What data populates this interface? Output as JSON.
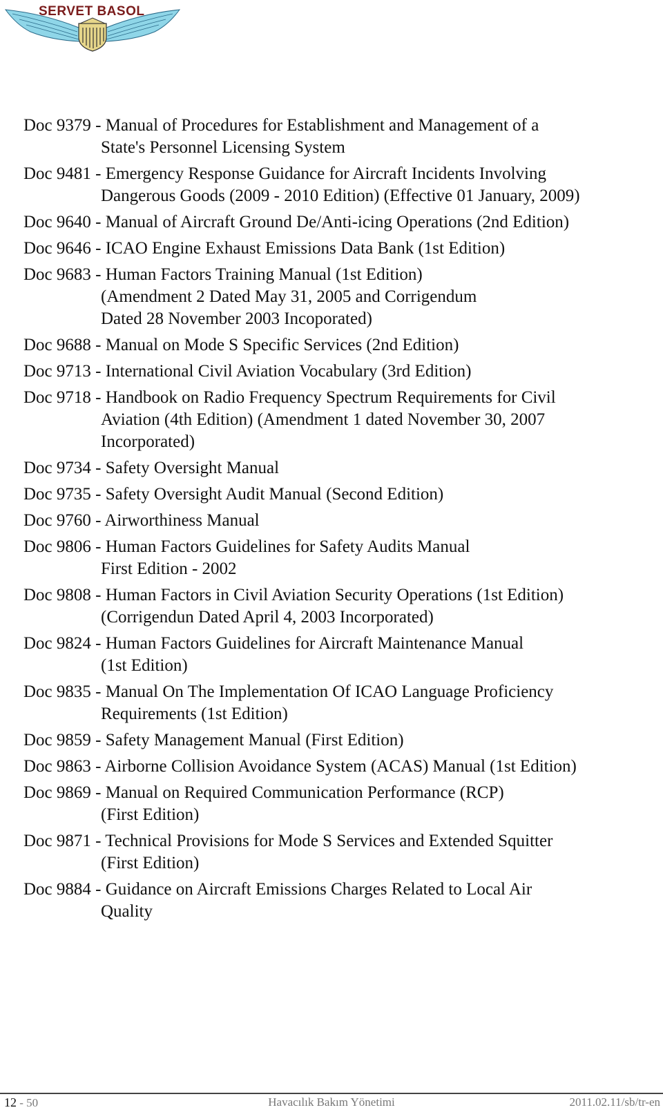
{
  "header": {
    "logo_text": "SERVET BASOL",
    "colors": {
      "logo_text": "#7a1c1c",
      "wings": "#8fd6e8",
      "shield": "#e6d68a"
    }
  },
  "documents": [
    {
      "number": "Doc 9379",
      "lines": [
        "Manual of Procedures for Establishment and Management of a",
        "State's Personnel Licensing System"
      ]
    },
    {
      "number": "Doc 9481",
      "lines": [
        "Emergency Response Guidance for Aircraft Incidents Involving",
        "Dangerous Goods (2009 - 2010 Edition) (Effective 01 January, 2009)"
      ]
    },
    {
      "number": "Doc 9640",
      "lines": [
        "Manual of Aircraft Ground De/Anti-icing Operations (2nd Edition)"
      ]
    },
    {
      "number": "Doc 9646",
      "lines": [
        "ICAO Engine Exhaust Emissions Data Bank (1st Edition)"
      ]
    },
    {
      "number": "Doc 9683",
      "lines": [
        "Human Factors Training Manual (1st Edition)",
        "(Amendment 2 Dated May 31, 2005 and Corrigendum",
        "Dated 28 November 2003 Incoporated)"
      ]
    },
    {
      "number": "Doc 9688",
      "lines": [
        "Manual on Mode S Specific Services (2nd Edition)"
      ]
    },
    {
      "number": "Doc 9713",
      "lines": [
        "International Civil Aviation Vocabulary (3rd Edition)"
      ]
    },
    {
      "number": "Doc 9718",
      "lines": [
        "Handbook on Radio Frequency Spectrum Requirements for Civil",
        "Aviation (4th Edition) (Amendment 1 dated November 30, 2007",
        "Incorporated)"
      ]
    },
    {
      "number": "Doc 9734",
      "lines": [
        "Safety Oversight Manual"
      ]
    },
    {
      "number": "Doc 9735",
      "lines": [
        "Safety Oversight Audit Manual (Second Edition)"
      ]
    },
    {
      "number": "Doc 9760",
      "lines": [
        "Airworthiness Manual"
      ]
    },
    {
      "number": "Doc 9806",
      "lines": [
        "Human Factors Guidelines for Safety Audits Manual",
        "First Edition - 2002"
      ]
    },
    {
      "number": "Doc 9808",
      "lines": [
        "Human Factors in Civil Aviation Security Operations (1st Edition)",
        "(Corrigendun Dated April 4, 2003 Incorporated)"
      ]
    },
    {
      "number": "Doc 9824",
      "lines": [
        "Human Factors Guidelines for Aircraft Maintenance Manual",
        "(1st Edition)"
      ]
    },
    {
      "number": "Doc 9835",
      "lines": [
        "Manual On The Implementation Of ICAO Language Proficiency",
        "Requirements (1st Edition)"
      ]
    },
    {
      "number": "Doc 9859",
      "lines": [
        "Safety Management Manual (First Edition)"
      ]
    },
    {
      "number": "Doc 9863",
      "lines": [
        "Airborne Collision Avoidance System (ACAS) Manual (1st Edition)"
      ]
    },
    {
      "number": "Doc 9869",
      "lines": [
        "Manual on Required Communication Performance (RCP)",
        "(First Edition)"
      ]
    },
    {
      "number": "Doc 9871",
      "lines": [
        "Technical Provisions for Mode S Services and Extended Squitter",
        "(First Edition)"
      ]
    },
    {
      "number": "Doc 9884",
      "lines": [
        "Guidance on Aircraft Emissions Charges Related to Local Air",
        "Quality"
      ]
    }
  ],
  "footer": {
    "chapter": "12",
    "separator": " - ",
    "page": "50",
    "title": "Havacılık Bakım Yönetimi",
    "revision": "2011.02.11/sb/tr-en"
  }
}
